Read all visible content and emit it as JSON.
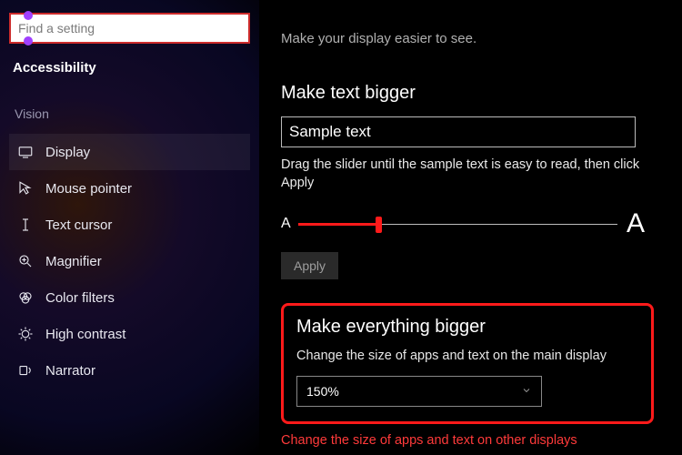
{
  "search": {
    "placeholder": "Find a setting"
  },
  "page_title": "Accessibility",
  "section_label": "Vision",
  "sidebar": {
    "items": [
      {
        "label": "Display"
      },
      {
        "label": "Mouse pointer"
      },
      {
        "label": "Text cursor"
      },
      {
        "label": "Magnifier"
      },
      {
        "label": "Color filters"
      },
      {
        "label": "High contrast"
      },
      {
        "label": "Narrator"
      }
    ]
  },
  "main": {
    "intro": "Make your display easier to see.",
    "text_bigger_heading": "Make text bigger",
    "sample_text": "Sample text",
    "drag_hint": "Drag the slider until the sample text is easy to read, then click Apply",
    "slider_small": "A",
    "slider_big": "A",
    "apply_label": "Apply",
    "everything_heading": "Make everything bigger",
    "everything_desc": "Change the size of apps and text on the main display",
    "scale_value": "150%",
    "other_displays_link": "Change the size of apps and text on other displays"
  },
  "colors": {
    "accent_red": "#ff1a1a"
  }
}
